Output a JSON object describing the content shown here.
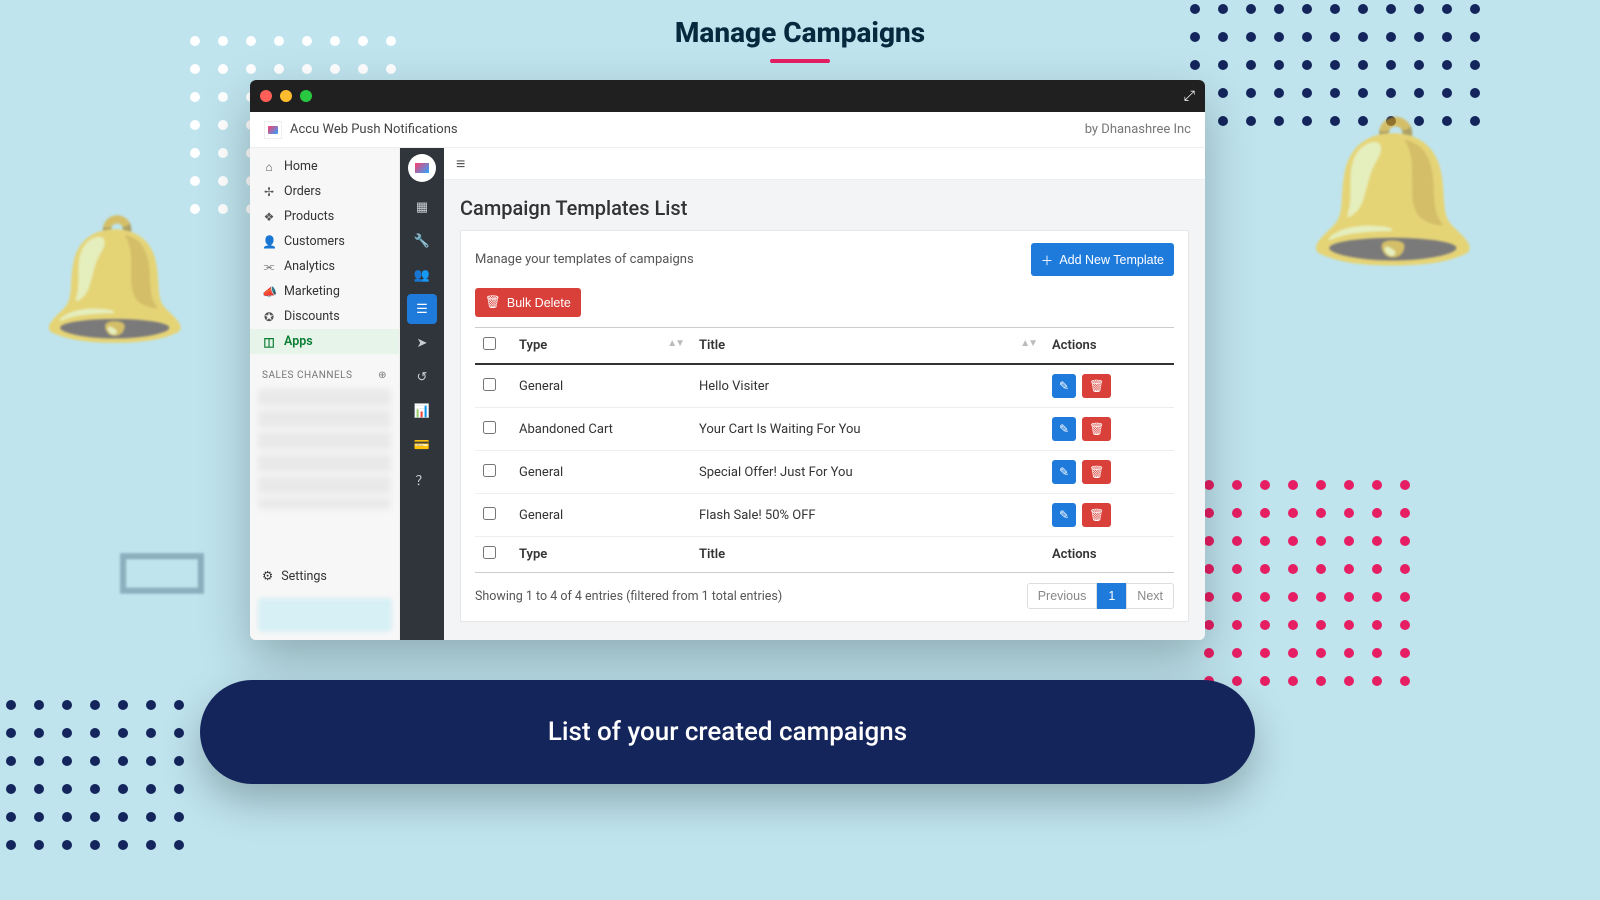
{
  "heading": "Manage Campaigns",
  "caption": "List of your created campaigns",
  "appbar": {
    "title": "Accu Web Push Notifications",
    "byline": "by Dhanashree Inc"
  },
  "shopNav": {
    "items": [
      {
        "label": "Home",
        "icon": "⌂"
      },
      {
        "label": "Orders",
        "icon": "✢"
      },
      {
        "label": "Products",
        "icon": "❖"
      },
      {
        "label": "Customers",
        "icon": "👤"
      },
      {
        "label": "Analytics",
        "icon": "⫘"
      },
      {
        "label": "Marketing",
        "icon": "📣"
      },
      {
        "label": "Discounts",
        "icon": "✪"
      },
      {
        "label": "Apps",
        "icon": "◫"
      }
    ],
    "activeIndex": 7,
    "sectionLabel": "SALES CHANNELS",
    "settingsLabel": "Settings"
  },
  "content": {
    "pageTitle": "Campaign Templates List",
    "subtitle": "Manage your templates of campaigns",
    "addBtn": "Add New Template",
    "bulkDelete": "Bulk Delete",
    "columns": {
      "type": "Type",
      "title": "Title",
      "actions": "Actions"
    },
    "rows": [
      {
        "type": "General",
        "title": "Hello Visiter"
      },
      {
        "type": "Abandoned Cart",
        "title": "Your Cart Is Waiting For You"
      },
      {
        "type": "General",
        "title": "Special Offer! Just For You"
      },
      {
        "type": "General",
        "title": "Flash Sale! 50% OFF"
      }
    ],
    "footerInfo": "Showing 1 to 4 of 4 entries (filtered from 1 total entries)",
    "pager": {
      "prev": "Previous",
      "page": "1",
      "next": "Next"
    }
  }
}
